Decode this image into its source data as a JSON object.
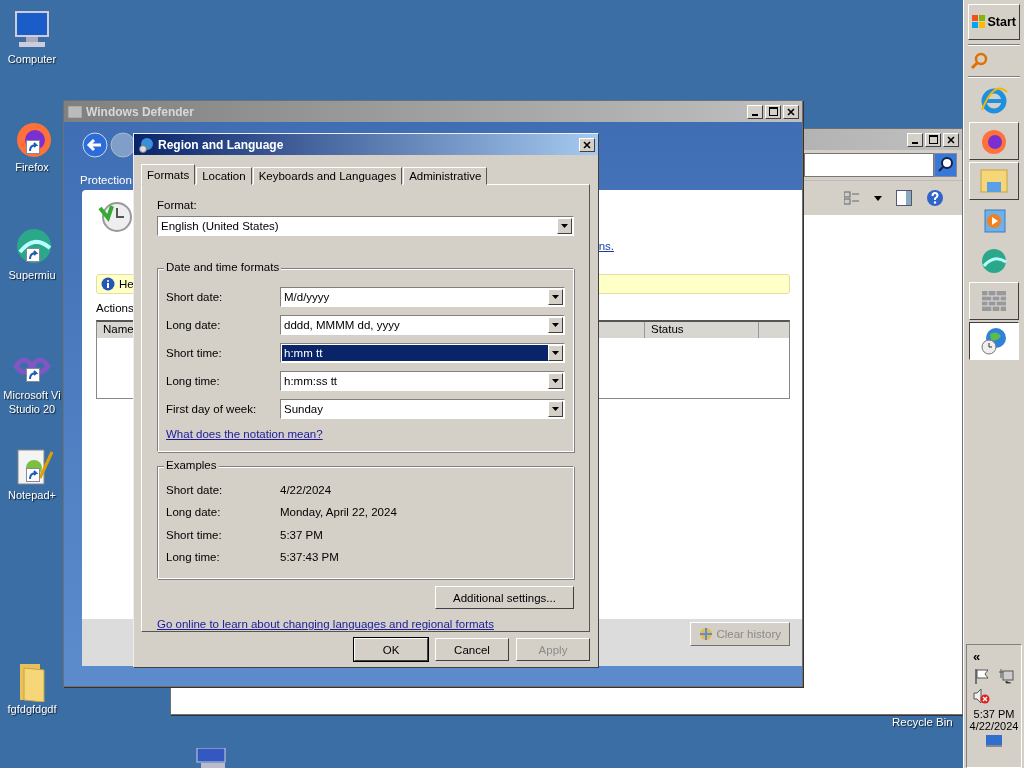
{
  "desktop_icons": [
    {
      "kind": "computer",
      "lines": [
        "Computer"
      ],
      "shortcut": false
    },
    {
      "kind": "firefox",
      "lines": [
        "Firefox"
      ],
      "shortcut": true
    },
    {
      "kind": "supermium",
      "lines": [
        "Supermiu"
      ],
      "shortcut": true
    },
    {
      "kind": "studio",
      "lines": [
        "Microsoft Vi",
        "Studio 20"
      ],
      "shortcut": true
    },
    {
      "kind": "notepad",
      "lines": [
        "Notepad+"
      ],
      "shortcut": true
    },
    {
      "kind": "folder",
      "lines": [
        "fgfdgfdgdf"
      ],
      "shortcut": false
    }
  ],
  "recycle_bin_label": "Recycle Bin",
  "explorer_window": {
    "active": false
  },
  "defender_window": {
    "title": "Windows Defender",
    "active": false,
    "nav_label": "Protection",
    "link_fragment": "ns.",
    "info_text": "He",
    "actions_label": "Actions",
    "columns": [
      "Name",
      "Status"
    ],
    "clear_button": {
      "label": "Clear history",
      "disabled": true
    }
  },
  "dialog": {
    "title": "Region and Language",
    "tabs": [
      {
        "label": "Formats",
        "selected": true
      },
      {
        "label": "Location",
        "selected": false
      },
      {
        "label": "Keyboards and Languages",
        "selected": false
      },
      {
        "label": "Administrative",
        "selected": false
      }
    ],
    "format_label": "Format:",
    "format_value": "English (United States)",
    "group_title": "Date and time formats",
    "rows": [
      {
        "label": "Short date:",
        "value": "M/d/yyyy",
        "selected": false
      },
      {
        "label": "Long date:",
        "value": "dddd, MMMM dd, yyyy",
        "selected": false
      },
      {
        "label": "Short time:",
        "value": "h:mm tt",
        "selected": true
      },
      {
        "label": "Long time:",
        "value": "h:mm:ss tt",
        "selected": false
      },
      {
        "label": "First day of week:",
        "value": "Sunday",
        "selected": false
      }
    ],
    "notation_link": "What does the notation mean?",
    "examples_title": "Examples",
    "examples": [
      {
        "label": "Short date:",
        "value": "4/22/2024"
      },
      {
        "label": "Long date:",
        "value": "Monday, April 22, 2024"
      },
      {
        "label": "Short time:",
        "value": "5:37 PM"
      },
      {
        "label": "Long time:",
        "value": "5:37:43 PM"
      }
    ],
    "additional_button": "Additional settings...",
    "online_link": "Go online to learn about changing languages and regional formats",
    "buttons": [
      {
        "label": "OK",
        "disabled": false,
        "default": true
      },
      {
        "label": "Cancel",
        "disabled": false,
        "default": false
      },
      {
        "label": "Apply",
        "disabled": true,
        "default": false
      }
    ]
  },
  "taskbar": {
    "start_label": "Start",
    "items": [
      {
        "kind": "ie",
        "running": false,
        "selected": false
      },
      {
        "kind": "firefox",
        "running": true,
        "selected": false
      },
      {
        "kind": "explorer",
        "running": true,
        "selected": false
      },
      {
        "kind": "media",
        "running": false,
        "selected": false
      },
      {
        "kind": "supermium",
        "running": false,
        "selected": false
      },
      {
        "kind": "firewall",
        "running": true,
        "selected": false
      },
      {
        "kind": "region",
        "running": true,
        "selected": true
      }
    ],
    "tray": {
      "chevron": "«",
      "time": "5:37 PM",
      "date": "4/22/2024",
      "volume_muted": true
    }
  }
}
